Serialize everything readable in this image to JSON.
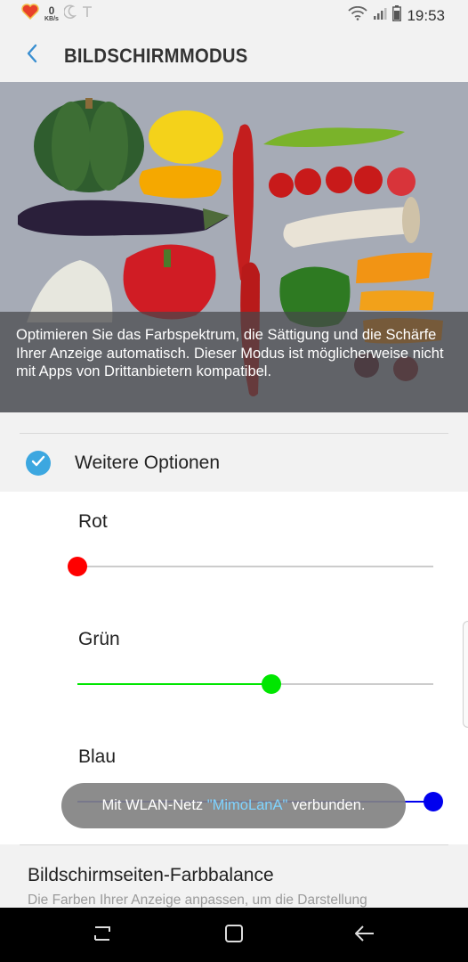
{
  "status_bar": {
    "net_speed_value": "0",
    "net_speed_unit": "KB/s",
    "time": "19:53",
    "icons": [
      "heart-badge-icon",
      "moon-icon",
      "t-icon",
      "wifi-icon",
      "signal-icon",
      "battery-icon"
    ]
  },
  "header": {
    "title": "BILDSCHIRMMODUS",
    "back_icon": "back-arrow-icon"
  },
  "hero": {
    "caption": "Optimieren Sie das Farbspektrum, die Sättigung und die Schärfe Ihrer Anzeige automatisch. Dieser Modus ist möglicherweise nicht mit Apps von Drittanbietern kompatibel."
  },
  "options": {
    "label": "Weitere Optionen",
    "checked": true
  },
  "sliders": [
    {
      "label": "Rot",
      "color": "#ff0000",
      "value": 0.0
    },
    {
      "label": "Grün",
      "color": "#00e600",
      "value": 0.545
    },
    {
      "label": "Blau",
      "color": "#0000ee",
      "value": 1.0
    }
  ],
  "toast": {
    "prefix": "Mit WLAN-Netz ",
    "network": "\"MimoLanA\"",
    "suffix": " verbunden."
  },
  "balance": {
    "title": "Bildschirmseiten-Farbbalance",
    "description": "Die Farben Ihrer Anzeige anpassen, um die Darstellung"
  },
  "navbar": {
    "icons": [
      "recent-apps-icon",
      "home-icon",
      "back-icon"
    ]
  },
  "colors": {
    "accent": "#3ca7e0",
    "background": "#f2f2f2"
  }
}
